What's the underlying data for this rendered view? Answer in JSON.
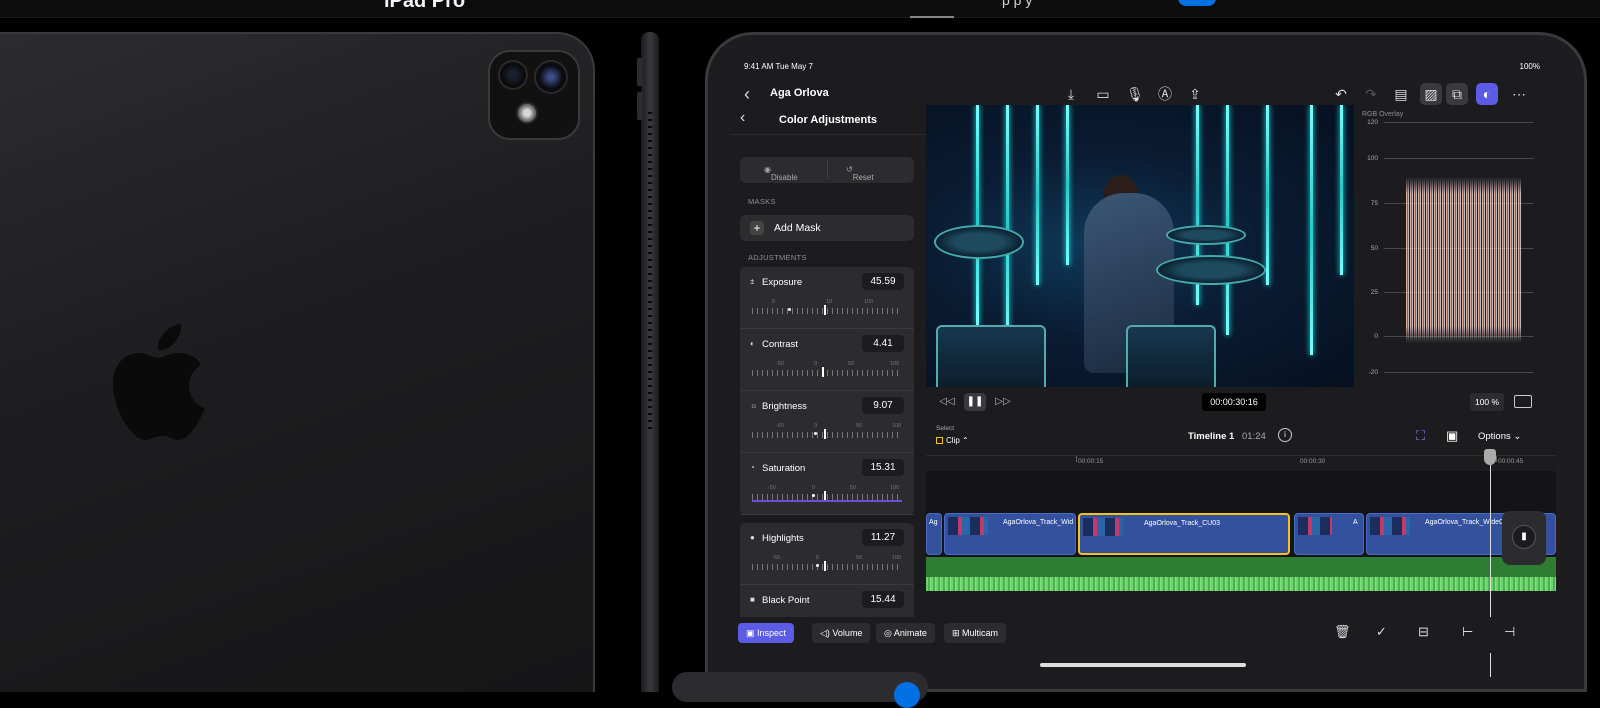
{
  "nav": {
    "product_name": "iPad Pro",
    "link_fragment": "p   p   y"
  },
  "status": {
    "time": "9:41 AM",
    "date": "Tue May 7",
    "battery": "100%"
  },
  "appbar": {
    "project_title": "Aga Orlova",
    "icons_center": [
      "import-icon",
      "camera-icon",
      "microphone-icon",
      "pencil-icon",
      "share-icon"
    ],
    "icons_right": [
      "undo-icon",
      "redo-icon",
      "browser-icon",
      "photos-icon",
      "effects-icon",
      "inspector-icon",
      "more-icon"
    ]
  },
  "panel": {
    "title": "Color Adjustments",
    "disable_label": "Disable",
    "reset_label": "Reset",
    "masks_header": "MASKS",
    "add_mask_label": "Add Mask",
    "adjustments_header": "ADJUSTMENTS",
    "adjustments": [
      {
        "name": "Exposure",
        "value": "45.59",
        "ticks": [
          "0",
          "10",
          "100"
        ]
      },
      {
        "name": "Contrast",
        "value": "4.41",
        "ticks": [
          "-50",
          "0",
          "50",
          "100"
        ]
      },
      {
        "name": "Brightness",
        "value": "9.07",
        "ticks": [
          "-50",
          "0",
          "50",
          "100"
        ]
      },
      {
        "name": "Saturation",
        "value": "15.31",
        "ticks": [
          "-50",
          "0",
          "50",
          "100"
        ]
      },
      {
        "name": "Highlights",
        "value": "11.27",
        "ticks": [
          "-50",
          "0",
          "50",
          "100"
        ]
      },
      {
        "name": "Black Point",
        "value": "15.44",
        "ticks": [
          "-50",
          "0",
          "50",
          "100"
        ]
      }
    ]
  },
  "scope": {
    "title": "RGB Overlay",
    "labels": [
      "120",
      "100",
      "75",
      "50",
      "25",
      "0",
      "-20"
    ]
  },
  "transport": {
    "timecode": "00:00:30:16",
    "zoom": "100 %"
  },
  "timeline": {
    "select_label": "Select",
    "mode_label": "Clip",
    "name": "Timeline 1",
    "duration": "01:24",
    "options_label": "Options",
    "ruler": [
      "00:00:15",
      "00:00:30",
      "00:00:45"
    ],
    "clips": [
      {
        "name": "Ag"
      },
      {
        "name": "AgaOrlova_Track_Wid"
      },
      {
        "name": "AgaOrlova_Track_CU03"
      },
      {
        "name": "A"
      },
      {
        "name": "AgaOrlova_Track_WideO"
      }
    ]
  },
  "bottombar": {
    "inspect": "Inspect",
    "volume": "Volume",
    "animate": "Animate",
    "multicam": "Multicam"
  }
}
